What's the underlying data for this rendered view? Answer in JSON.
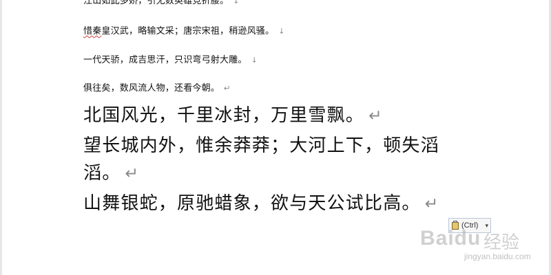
{
  "document": {
    "paragraphs_small": [
      {
        "text": "江山如此多娇，引无数英雄竞折腰。",
        "mark": "↓"
      },
      {
        "pre": "",
        "underlined": "惜秦",
        "post": "皇汉武，略输文采；唐宗宋祖，稍逊风骚。",
        "mark": "↓"
      },
      {
        "text": "一代天骄，成吉思汗，只识弯弓射大雕。",
        "mark": "↓"
      },
      {
        "text": "俱往矣，数风流人物，还看今朝。",
        "mark": "↵"
      }
    ],
    "paragraphs_large": [
      {
        "text": "北国风光，千里冰封，万里雪飘。",
        "mark": "↵"
      },
      {
        "text": "望长城内外，惟余莽莽；大河上下，顿失滔",
        "mark": ""
      },
      {
        "text": "滔。",
        "mark": "↵"
      },
      {
        "text": "山舞银蛇，原驰蜡象，欲与天公试比高。",
        "mark": "↵"
      }
    ]
  },
  "paste_options": {
    "label": "(Ctrl)",
    "chevron": "▾",
    "icon": "clipboard-icon"
  },
  "watermark": {
    "brand": "Baidu",
    "cn": "经验",
    "url": "jingyan.baidu.com"
  },
  "colors": {
    "text": "#111111",
    "formatting_mark": "#8a8a8a",
    "spellcheck_underline": "#d23b3b"
  }
}
